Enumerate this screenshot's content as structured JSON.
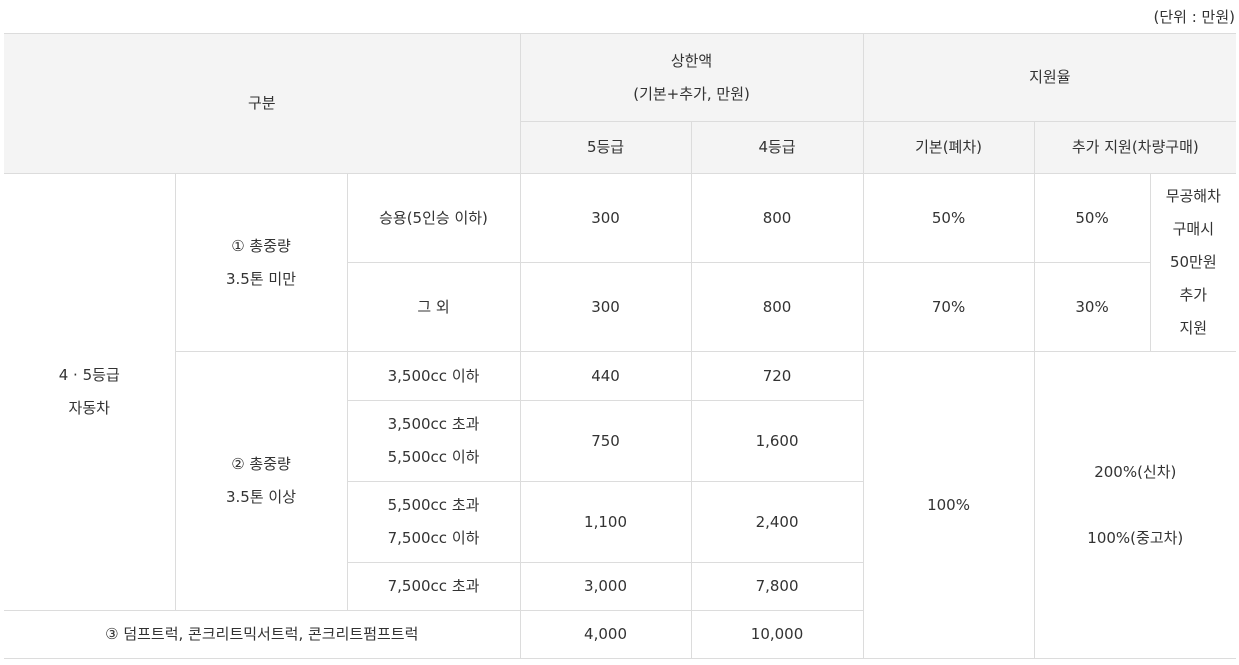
{
  "unit_note": "(단위 : 만원)",
  "header": {
    "category": "구분",
    "cap": {
      "line1": "상한액",
      "line2": "(기본+추가, 만원)"
    },
    "support_rate": "지원율",
    "grade5": "5등급",
    "grade4": "4등급",
    "basic": "기본(폐차)",
    "additional": "추가 지원(차량구매)"
  },
  "body": {
    "vehicle_class": [
      "4 · 5등급",
      "자동차"
    ],
    "group1": {
      "label": [
        "① 총중량",
        "3.5톤 미만"
      ]
    },
    "group2": {
      "label": [
        "② 총중량",
        "3.5톤 이상"
      ]
    },
    "rows": [
      {
        "type": "승용(5인승 이하)",
        "grade5": "300",
        "grade4": "800",
        "basic": "50%",
        "additional": "50%"
      },
      {
        "type": "그 외",
        "grade5": "300",
        "grade4": "800",
        "basic": "70%",
        "additional": "30%"
      },
      {
        "type": "3,500cc 이하",
        "grade5": "440",
        "grade4": "720"
      },
      {
        "type": [
          "3,500cc 초과",
          "5,500cc 이하"
        ],
        "grade5": "750",
        "grade4": "1,600"
      },
      {
        "type": [
          "5,500cc 초과",
          "7,500cc 이하"
        ],
        "grade5": "1,100",
        "grade4": "2,400"
      },
      {
        "type": "7,500cc 초과",
        "grade5": "3,000",
        "grade4": "7,800"
      }
    ],
    "extra_note": [
      "무공해차",
      "구매시",
      "50만원",
      "추가",
      "지원"
    ],
    "big_basic": "100%",
    "big_additional": [
      "200%(신차)",
      "100%(중고차)"
    ],
    "special": {
      "label": "③ 덤프트럭, 콘크리트믹서트럭, 콘크리트펌프트럭",
      "grade5": "4,000",
      "grade4": "10,000"
    }
  }
}
